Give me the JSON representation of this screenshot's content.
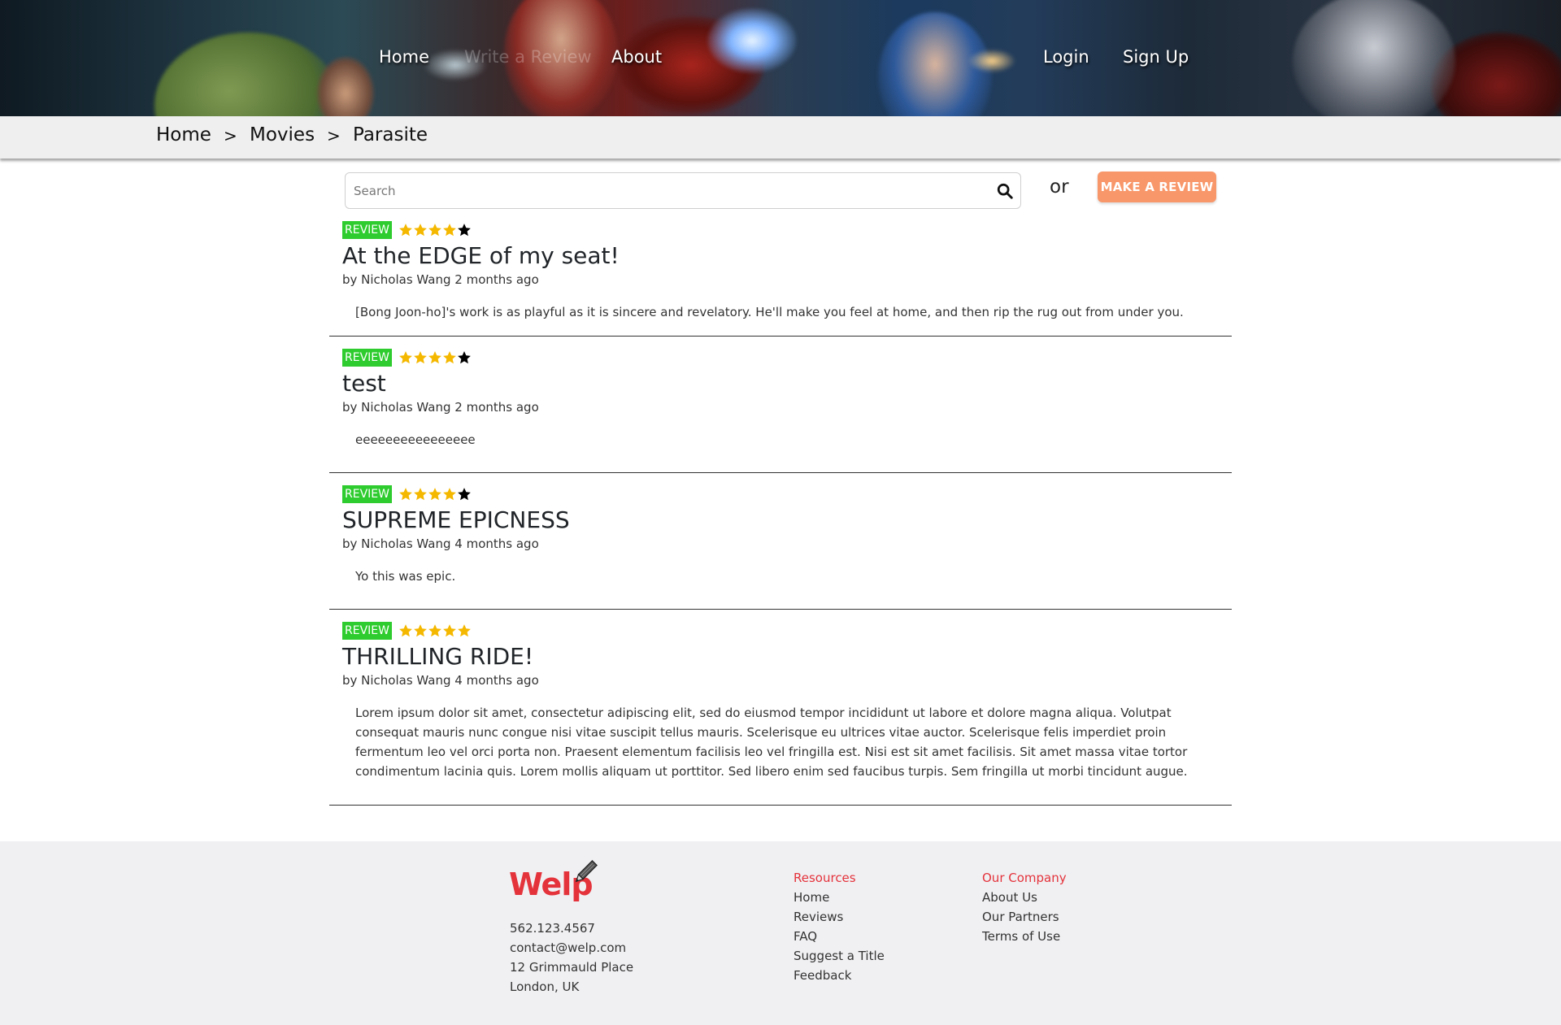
{
  "nav": {
    "home": "Home",
    "write_review": "Write a Review",
    "about": "About",
    "login": "Login",
    "signup": "Sign Up"
  },
  "breadcrumb": {
    "items": [
      "Home",
      "Movies",
      "Parasite"
    ],
    "separator": ">"
  },
  "search": {
    "placeholder": "Search",
    "value": ""
  },
  "or_text": "or",
  "make_review_button": "MAKE A REVIEW",
  "colors": {
    "badge": "#2ecc2e",
    "star_filled": "#f5b800",
    "star_empty": "#000000",
    "button": "#f8976a",
    "brand_red": "#e4333b"
  },
  "reviews": [
    {
      "badge": "REVIEW",
      "rating": 4,
      "title": "At the EDGE of my seat!",
      "byline": "by Nicholas Wang 2 months ago",
      "body": "[Bong Joon-ho]'s work is as playful as it is sincere and revelatory. He'll make you feel at home, and then rip the rug out from under you."
    },
    {
      "badge": "REVIEW",
      "rating": 4,
      "title": "test",
      "byline": "by Nicholas Wang 2 months ago",
      "body": "eeeeeeeeeeeeeeee"
    },
    {
      "badge": "REVIEW",
      "rating": 4,
      "title": "SUPREME EPICNESS",
      "byline": "by Nicholas Wang 4 months ago",
      "body": "Yo this was epic."
    },
    {
      "badge": "REVIEW",
      "rating": 5,
      "title": "THRILLING RIDE!",
      "byline": "by Nicholas Wang 4 months ago",
      "body": "Lorem ipsum dolor sit amet, consectetur adipiscing elit, sed do eiusmod tempor incididunt ut labore et dolore magna aliqua. Volutpat consequat mauris nunc congue nisi vitae suscipit tellus mauris. Scelerisque eu ultrices vitae auctor. Scelerisque felis imperdiet proin fermentum leo vel orci porta non. Praesent elementum facilisis leo vel fringilla est. Nisi est sit amet facilisis. Sit amet massa vitae tortor condimentum lacinia quis. Lorem mollis aliquam ut porttitor. Sed libero enim sed faucibus turpis. Sem fringilla ut morbi tincidunt augue."
    }
  ],
  "footer": {
    "logo_text": "Welp",
    "contact": {
      "phone": "562.123.4567",
      "email": "contact@welp.com",
      "address1": "12 Grimmauld Place",
      "address2": "London, UK"
    },
    "resources": {
      "heading": "Resources",
      "links": [
        "Home",
        "Reviews",
        "FAQ",
        "Suggest a Title",
        "Feedback"
      ]
    },
    "company": {
      "heading": "Our Company",
      "links": [
        "About Us",
        "Our Partners",
        "Terms of Use"
      ]
    }
  }
}
